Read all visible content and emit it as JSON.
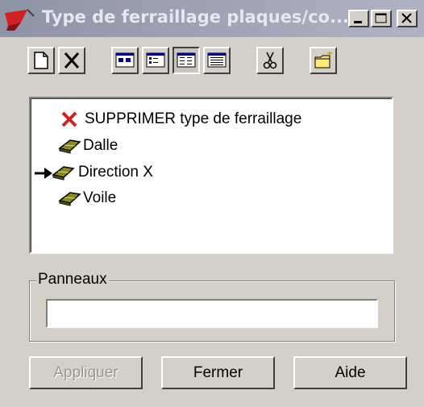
{
  "window": {
    "title": "Type de ferraillage plaques/co..."
  },
  "toolbar": {
    "buttons": [
      {
        "name": "new",
        "icon": "new-document-icon"
      },
      {
        "name": "delete",
        "icon": "delete-x-icon"
      },
      {
        "name": "large-icons",
        "icon": "large-icons-view-icon"
      },
      {
        "name": "small-icons",
        "icon": "small-icons-view-icon"
      },
      {
        "name": "list",
        "icon": "list-view-icon",
        "pressed": true
      },
      {
        "name": "details",
        "icon": "details-view-icon"
      },
      {
        "name": "cut",
        "icon": "scissors-icon"
      },
      {
        "name": "open-folder",
        "icon": "folder-new-icon"
      }
    ]
  },
  "tree": {
    "items": [
      {
        "label": "SUPPRIMER type de ferraillage",
        "icon": "red-x-icon"
      },
      {
        "label": "Dalle",
        "icon": "plate-icon"
      },
      {
        "label": "Direction X",
        "icon": "plate-icon",
        "current": true
      },
      {
        "label": "Voile",
        "icon": "plate-icon"
      }
    ]
  },
  "panneaux": {
    "legend": "Panneaux",
    "value": ""
  },
  "buttons": {
    "apply": "Appliquer",
    "close": "Fermer",
    "help": "Aide"
  },
  "colors": {
    "title_bar": "#a2a6b8",
    "window_bg": "#d4d0c8",
    "delete_red": "#d32020",
    "plate_olive": "#8a8a1a"
  }
}
